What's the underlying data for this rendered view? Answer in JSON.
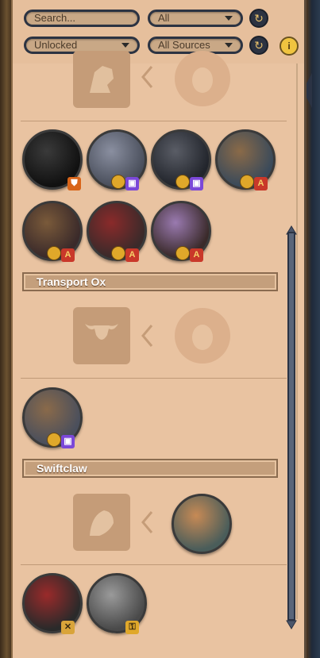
{
  "filters": {
    "search_placeholder": "Search...",
    "category_value": "All",
    "status_value": "Unlocked",
    "source_value": "All Sources",
    "info_symbol": "i"
  },
  "sections": [
    {
      "title": "Transport Ox"
    },
    {
      "title": "Swiftclaw"
    }
  ],
  "colors": {
    "panel": "#e9c3a1",
    "section_bar": "#c49f7c",
    "twitch": "#7b48d8",
    "achievement": "#c9382a",
    "coin": "#e0a82a"
  },
  "icons": {
    "reset": "reset-icon",
    "info": "info-icon",
    "coin": "coin-icon",
    "twitch": "twitch-icon",
    "achievement": "achievement-icon",
    "shield": "shield-icon"
  }
}
